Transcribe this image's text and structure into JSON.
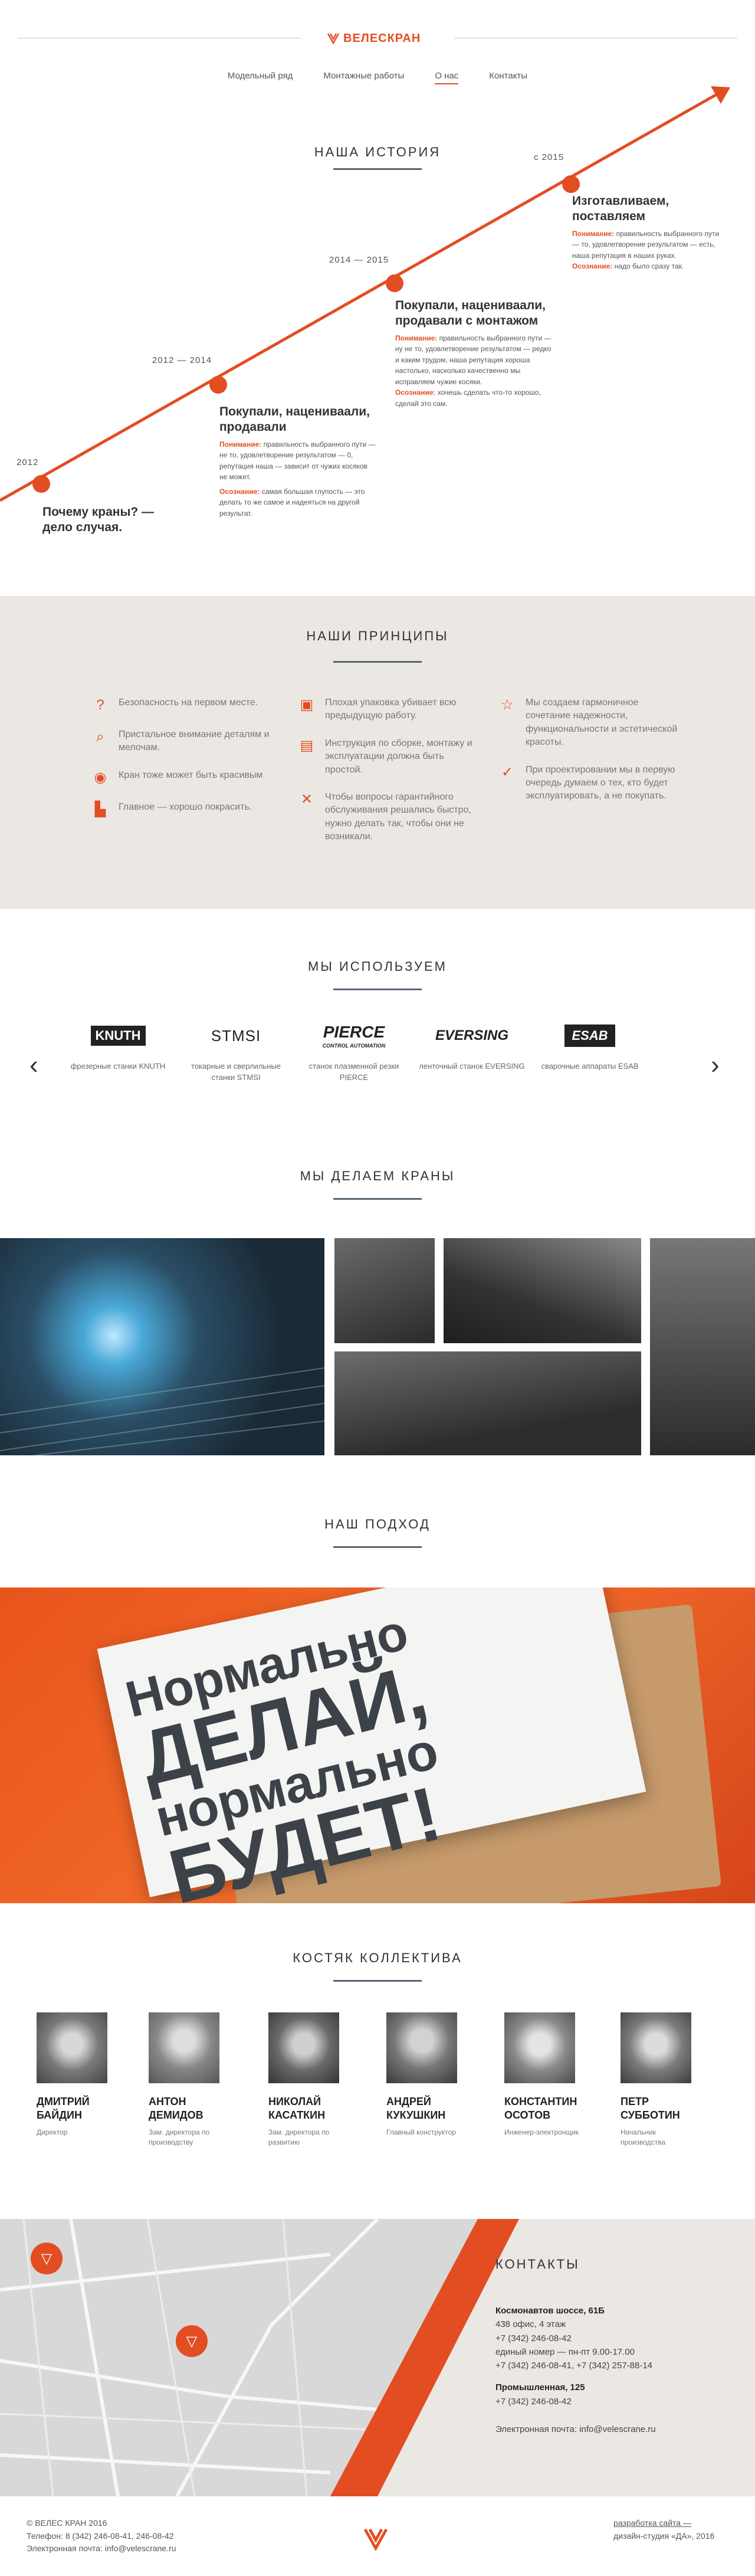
{
  "header": {
    "logo": "ВЕЛЕСКРАН",
    "nav": [
      "Модельный ряд",
      "Монтажные работы",
      "О нас",
      "Контакты"
    ]
  },
  "history": {
    "title": "НАША ИСТОРИЯ",
    "items": [
      {
        "year": "2012",
        "title": "Почему краны? — дело случая.",
        "parts": []
      },
      {
        "year": "2012 — 2014",
        "title": "Покупали, нацениваали, продавали",
        "parts": [
          [
            "Понимание:",
            " правильность выбранного пути — не то, удовлетворение результатом — 0, репутация наша — зависит от чужих косяков не может."
          ],
          [
            "Осознание:",
            " самая большая глупость — это делать то же самое и надеяться на другой результат."
          ]
        ]
      },
      {
        "year": "2014 — 2015",
        "title": "Покупали, нацениваали, продавали с монтажом",
        "parts": [
          [
            "Понимание:",
            " правильность выбранного пути — ну не то, удовлетворение результатом — редко и каким трудом, наша репутация хороша настолько, насколько качественно мы исправляем чужие косяки."
          ],
          [
            "Осознание:",
            " хочешь сделать что-то хорошо, сделай это сам."
          ]
        ]
      },
      {
        "year": "с 2015",
        "title": "Изготавливаем, поставляем",
        "parts": [
          [
            "Понимание:",
            " правильность выбранного пути — то, удовлетворение результатом — есть, наша репутация в наших руках."
          ],
          [
            "Осознание:",
            " надо было сразу так."
          ]
        ]
      }
    ]
  },
  "principles": {
    "title": "НАШИ ПРИНЦИПЫ",
    "cols": [
      [
        {
          "icon": "question-icon",
          "text": "Безопасность на первом месте."
        },
        {
          "icon": "magnifier-icon",
          "text": "Пристальное внимание деталям и мелочам."
        },
        {
          "icon": "eye-icon",
          "text": "Кран тоже может быть красивым"
        },
        {
          "icon": "brush-icon",
          "text": "Главное — хорошо покрасить."
        }
      ],
      [
        {
          "icon": "box-icon",
          "text": "Плохая упаковка убивает всю предыдущую работу."
        },
        {
          "icon": "doc-icon",
          "text": "Инструкция по сборке, монтажу и эксплуатации должна быть простой."
        },
        {
          "icon": "tools-icon",
          "text": "Чтобы вопросы гарантийного обслуживания решались быстро, нужно делать так, чтобы они не возникали."
        }
      ],
      [
        {
          "icon": "star-icon",
          "text": "Мы создаем гармоничное сочетание надежности, функциональности и эстетической красоты."
        },
        {
          "icon": "check-icon",
          "text": "При проектировании мы в первую очередь думаем о тех, кто будет эксплуатировать, а не покупать."
        }
      ]
    ]
  },
  "brands": {
    "title": "МЫ ИСПОЛЬЗУЕМ",
    "items": [
      {
        "logo": "KNUTH",
        "caption": "фрезерные станки KNUTH"
      },
      {
        "logo": "STMSI",
        "caption": "токарные и сверлильные станки STMSI"
      },
      {
        "logo": "PIERCE",
        "sub": "CONTROL AUTOMATION",
        "caption": "станок плазменной резки PIERCE"
      },
      {
        "logo": "EVERSING",
        "caption": "ленточный станок EVERSING"
      },
      {
        "logo": "ESAB",
        "caption": "сварочные аппараты ESAB"
      }
    ],
    "prev": "‹",
    "next": "›"
  },
  "photos": {
    "title": "МЫ ДЕЛАЕМ КРАНЫ"
  },
  "approach": {
    "title": "НАШ ПОДХОД",
    "lines": [
      "Нормально",
      "ДЕЛАЙ,",
      "нормально",
      "БУДЕТ!"
    ]
  },
  "team": {
    "title": "КОСТЯК КОЛЛЕКТИВА",
    "members": [
      {
        "name": "ДМИТРИЙ БАЙДИН",
        "role": "Директор"
      },
      {
        "name": "АНТОН ДЕМИДОВ",
        "role": "Зам. директора по производству"
      },
      {
        "name": "НИКОЛАЙ КАСАТКИН",
        "role": "Зам. директора по развитию"
      },
      {
        "name": "АНДРЕЙ КУКУШКИН",
        "role": "Главный конструктор"
      },
      {
        "name": "КОНСТАНТИН ОСОТОВ",
        "role": "Инженер-электронщик"
      },
      {
        "name": "ПЕТР СУББОТИН",
        "role": "Начальник производства"
      }
    ]
  },
  "contacts": {
    "title": "КОНТАКТЫ",
    "addr1": "Космонавтов шоссе, 61Б",
    "addr1_details": [
      "438 офис, 4 этаж",
      "+7 (342) 246-08-42",
      "единый номер — пн-пт 9.00-17.00",
      "+7 (342) 246-08-41, +7 (342) 257-88-14"
    ],
    "addr2": "Промышленная, 125",
    "addr2_details": [
      "+7 (342) 246-08-42"
    ],
    "email": "Электронная почта: info@velescrane.ru"
  },
  "footer": {
    "left": [
      "© ВЕЛЕС КРАН 2016",
      "Телефон: 8 (342) 246-08-41, 246-08-42",
      "Электронная почта: info@velescrane.ru"
    ],
    "right": [
      "разработка сайта —",
      "дизайн-студия «ДА», 2016"
    ]
  },
  "colors": {
    "accent": "#e34d22",
    "bg_light": "#ebe8e4",
    "line": "#5a6775"
  }
}
